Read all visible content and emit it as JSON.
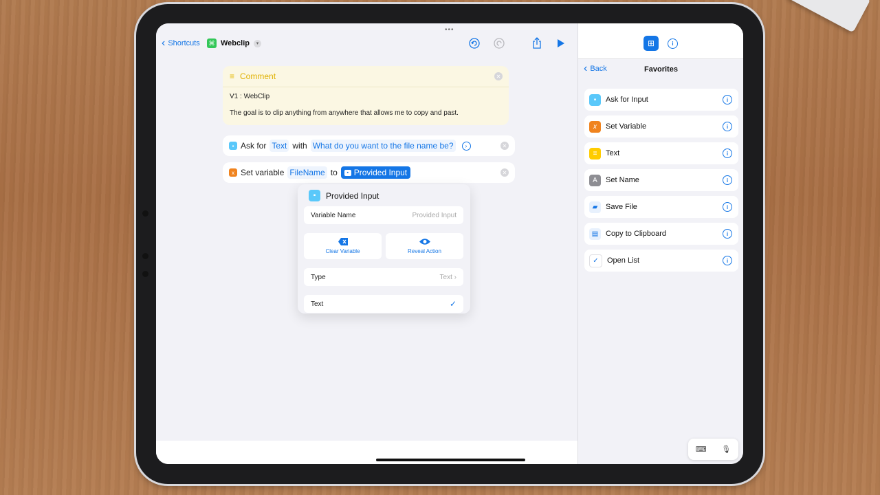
{
  "nav": {
    "back_label": "Shortcuts",
    "title": "Webclip"
  },
  "comment": {
    "title": "Comment",
    "line1": "V1 : WebClip",
    "line2": "The goal is to clip anything from anywhere that allows me to copy and past."
  },
  "ask_action": {
    "label": "Ask for",
    "type_token": "Text",
    "with_label": "with",
    "prompt_token": "What do you want to the file name be?"
  },
  "set_action": {
    "label": "Set variable",
    "var_token": "FileName",
    "to_label": "to",
    "value_token": "Provided Input"
  },
  "popover": {
    "title": "Provided Input",
    "variable_name_label": "Variable Name",
    "variable_name_placeholder": "Provided Input",
    "clear_label": "Clear Variable",
    "reveal_label": "Reveal Action",
    "type_label": "Type",
    "type_value": "Text",
    "selected_type": "Text"
  },
  "sidebar": {
    "back_label": "Back",
    "title": "Favorites",
    "items": [
      {
        "label": "Ask for Input",
        "icon": "speech-bubble-icon",
        "color": "#5ac8fa"
      },
      {
        "label": "Set Variable",
        "icon": "variable-x-icon",
        "color": "#f0831e"
      },
      {
        "label": "Text",
        "icon": "text-lines-icon",
        "color": "#ffcc00"
      },
      {
        "label": "Set Name",
        "icon": "rename-icon",
        "color": "#8e8e93"
      },
      {
        "label": "Save File",
        "icon": "files-icon",
        "color": "#1476e6"
      },
      {
        "label": "Copy to Clipboard",
        "icon": "clipboard-icon",
        "color": "#1476e6"
      },
      {
        "label": "Open List",
        "icon": "list-check-icon",
        "color": "#ffffff"
      }
    ]
  },
  "colors": {
    "accent": "#1476e6",
    "comment_title": "#e0b100",
    "set_variable": "#f0831e"
  }
}
